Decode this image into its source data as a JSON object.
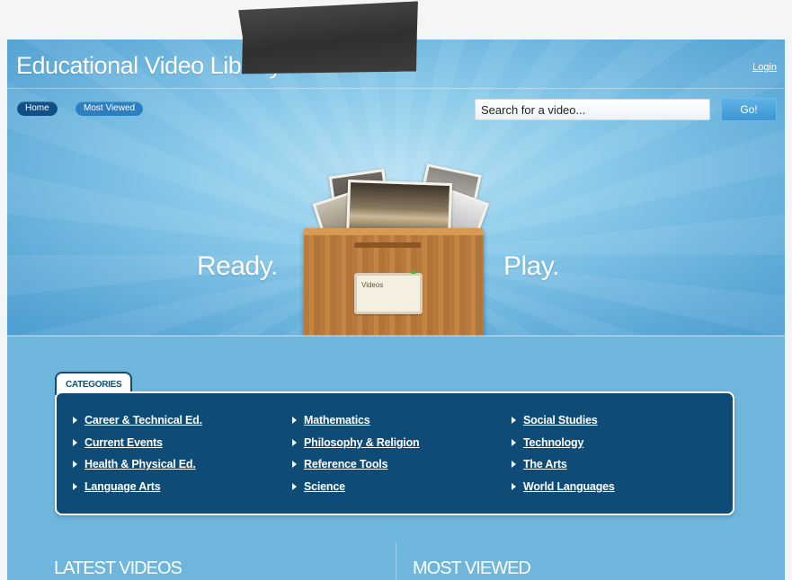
{
  "header": {
    "title": "Educational Video Library",
    "login_label": "Login"
  },
  "nav": {
    "home_label": "Home",
    "most_viewed_label": "Most Viewed"
  },
  "search": {
    "placeholder": "Search for a video...",
    "button_label": "Go!"
  },
  "hero": {
    "left_text": "Ready.",
    "right_text": "Play.",
    "box_label": "Videos"
  },
  "categories": {
    "tab_label": "CATEGORIES",
    "columns": [
      [
        "Career & Technical Ed.",
        "Current Events",
        "Health & Physical Ed.",
        "Language Arts"
      ],
      [
        "Mathematics",
        "Philosophy & Religion",
        "Reference Tools",
        "Science"
      ],
      [
        "Social Studies",
        "Technology",
        "The Arts",
        "World Languages"
      ]
    ]
  },
  "sections": {
    "latest_label": "LATEST VIDEOS",
    "most_viewed_label": "MOST VIEWED"
  },
  "colors": {
    "hero_blue": "#5daad8",
    "panel_navy": "#0e4b76",
    "home_pill": "#0f4f86",
    "crate_wood": "#b97b3d"
  }
}
